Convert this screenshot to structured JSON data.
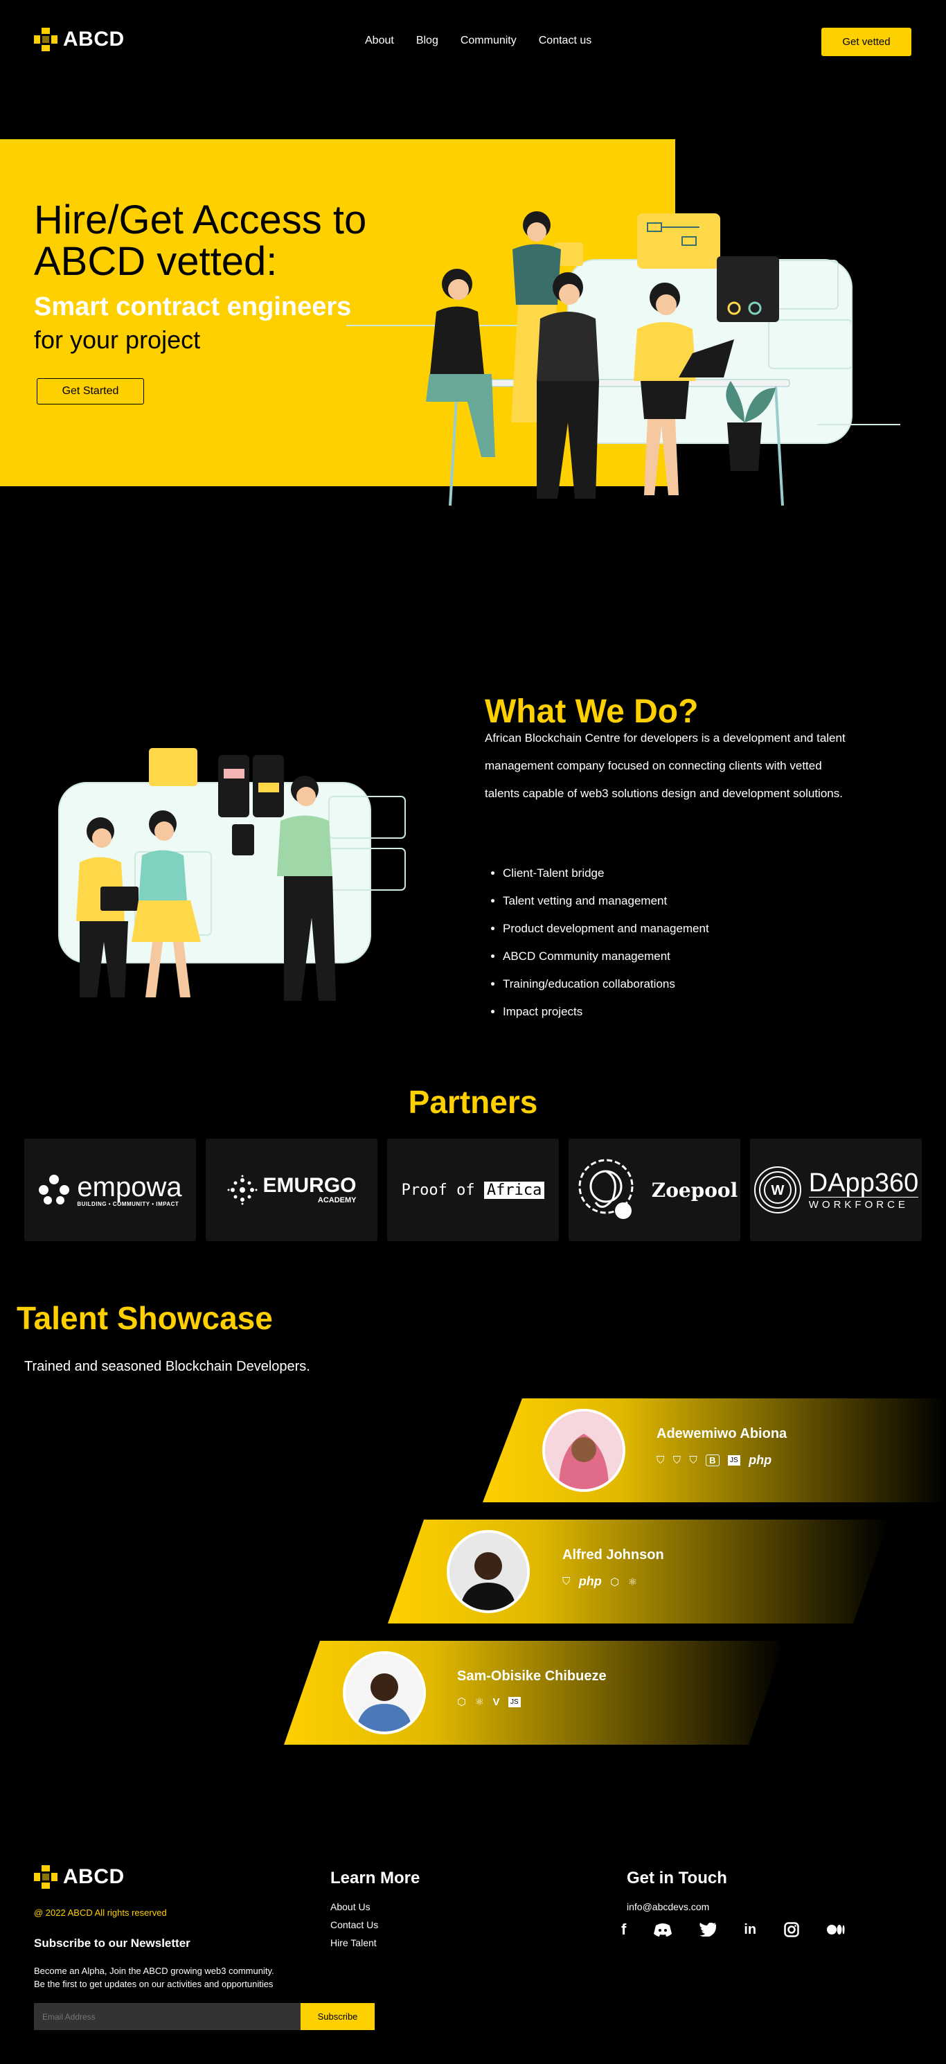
{
  "nav": {
    "brand": "ABCD",
    "links": [
      "About",
      "Blog",
      "Community",
      "Contact us"
    ],
    "cta": "Get vetted"
  },
  "hero": {
    "title_line1": "Hire/Get Access to",
    "title_line2": "ABCD vetted:",
    "subtitle_highlight": "Smart contract engineers",
    "subtitle_rest": "for your project",
    "cta": "Get Started"
  },
  "what_we_do": {
    "title": "What We Do?",
    "paragraph": "African Blockchain Centre for developers is a development and talent management company focused on connecting clients with vetted talents capable of web3 solutions design and development solutions.",
    "items": [
      "Client-Talent bridge",
      "Talent vetting and management",
      "Product development and management",
      "ABCD Community management",
      "Training/education collaborations",
      "Impact projects"
    ]
  },
  "partners": {
    "title": "Partners",
    "logos": [
      {
        "name": "empowa",
        "tagline": "BUILDING • COMMUNITY • IMPACT"
      },
      {
        "name": "EMURGO",
        "tagline": "ACADEMY"
      },
      {
        "name_a": "Proof of",
        "name_b": "Africa"
      },
      {
        "name": "Zoepool"
      },
      {
        "name": "DApp360",
        "tagline": "WORKFORCE"
      }
    ]
  },
  "talent": {
    "title": "Talent Showcase",
    "subtitle": "Trained and seasoned Blockchain Developers.",
    "people": [
      {
        "name": "Adewemiwo Abiona",
        "skills": [
          "html5-icon",
          "css3-icon",
          "html5-icon",
          "bootstrap-icon",
          "js-icon",
          "php-icon"
        ]
      },
      {
        "name": "Alfred Johnson",
        "skills": [
          "html5-icon",
          "php-icon",
          "nodejs-icon",
          "react-icon"
        ]
      },
      {
        "name": "Sam-Obisike Chibueze",
        "skills": [
          "nodejs-icon",
          "react-icon",
          "vue-icon",
          "js-icon"
        ]
      }
    ],
    "skill_labels": {
      "b": "B",
      "js": "JS",
      "php": "php"
    }
  },
  "footer": {
    "brand": "ABCD",
    "copyright": "@ 2022 ABCD All rights reserved",
    "newsletter_title": "Subscribe to our Newsletter",
    "newsletter_line1": "Become an Alpha, Join the ABCD growing web3 community.",
    "newsletter_line2": "Be the first to get updates on our activities and opportunities",
    "email_placeholder": "Email Address",
    "subscribe": "Subscribe",
    "learn_more_title": "Learn More",
    "learn_more_links": [
      "About Us",
      "Contact Us",
      "Hire Talent"
    ],
    "contact_title": "Get in Touch",
    "email": "info@abcdevs.com",
    "socials": [
      "facebook-icon",
      "discord-icon",
      "twitter-icon",
      "linkedin-icon",
      "instagram-icon",
      "medium-icon"
    ]
  },
  "colors": {
    "accent": "#ffd000",
    "background": "#000000",
    "card": "#141414"
  }
}
